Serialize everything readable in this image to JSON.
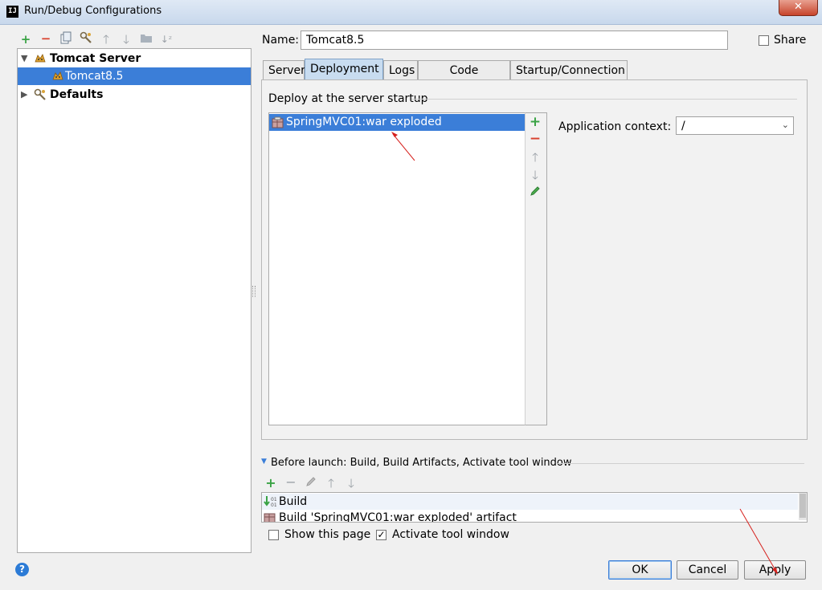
{
  "window": {
    "title": "Run/Debug Configurations",
    "app_icon_text": "IJ",
    "close_glyph": "✕"
  },
  "toolbar": {
    "icons": [
      "add-icon",
      "remove-icon",
      "copy-icon",
      "edit-defaults-icon",
      "move-up-icon",
      "move-down-icon",
      "folder-icon",
      "sort-icon"
    ]
  },
  "tree": {
    "items": [
      {
        "label": "Tomcat Server",
        "expanded": true
      },
      {
        "label": "Tomcat8.5",
        "selected": true
      },
      {
        "label": "Defaults",
        "expanded": false
      }
    ]
  },
  "name": {
    "label": "Name:",
    "value": "Tomcat8.5"
  },
  "share": {
    "label": "Share",
    "checked": false
  },
  "tabs": [
    {
      "label": "Server"
    },
    {
      "label": "Deployment",
      "active": true
    },
    {
      "label": "Logs"
    },
    {
      "label": "Code Coverage"
    },
    {
      "label": "Startup/Connection"
    }
  ],
  "deployment": {
    "section_label": "Deploy at the server startup",
    "items": [
      "SpringMVC01:war exploded"
    ],
    "context_label": "Application context:",
    "context_value": "/"
  },
  "before_launch": {
    "header": "Before launch: Build, Build Artifacts, Activate tool window",
    "items": [
      "Build",
      "Build 'SpringMVC01:war exploded' artifact"
    ]
  },
  "options": {
    "show_page_label": "Show this page",
    "show_page_checked": false,
    "activate_label": "Activate tool window",
    "activate_checked": true
  },
  "buttons": {
    "ok": "OK",
    "cancel": "Cancel",
    "apply": "Apply",
    "help": "?"
  },
  "colors": {
    "selection": "#3b7ed8",
    "annotation_arrow": "#d6201c",
    "add_green": "#3aa345",
    "remove_red": "#d9422e"
  }
}
